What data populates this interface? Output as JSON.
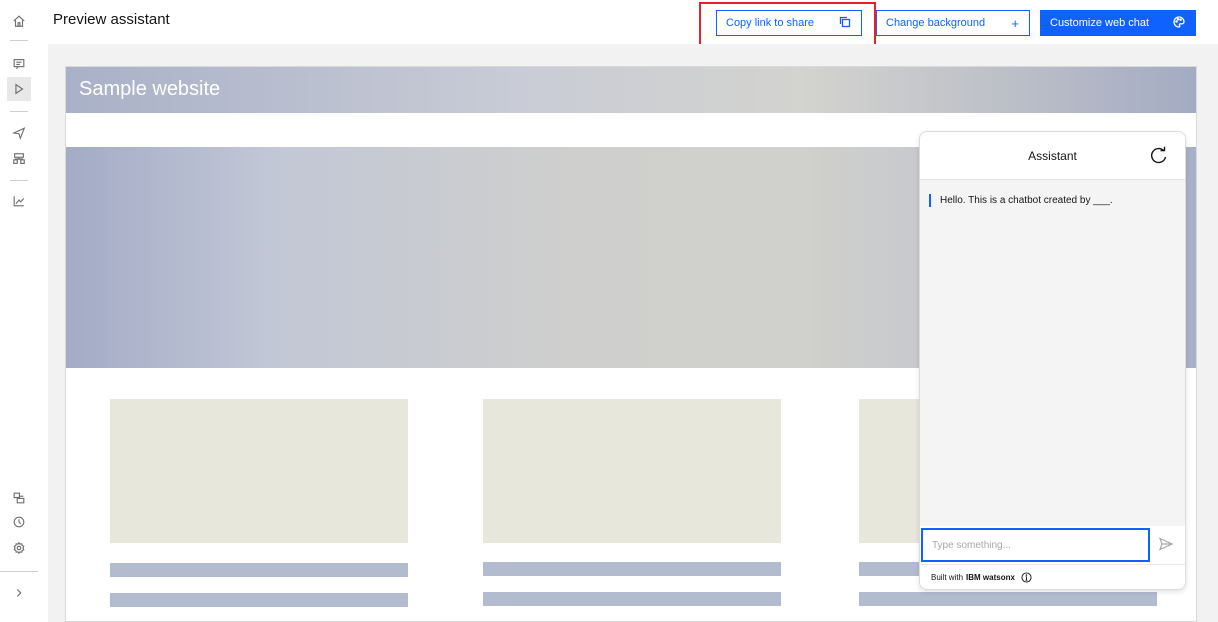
{
  "header": {
    "title": "Preview assistant",
    "copy_link_label": "Copy link to share",
    "change_background_label": "Change background",
    "change_background_icon": "+",
    "customize_label": "Customize web chat"
  },
  "sidebar": {
    "items": [
      {
        "name": "home-icon"
      },
      {
        "name": "actions-icon"
      },
      {
        "name": "preview-icon",
        "active": true
      },
      {
        "name": "publish-icon"
      },
      {
        "name": "environments-icon"
      },
      {
        "name": "analytics-icon"
      },
      {
        "name": "integrations-icon"
      },
      {
        "name": "history-icon"
      },
      {
        "name": "settings-icon"
      },
      {
        "name": "expand-icon"
      }
    ]
  },
  "site": {
    "title": "Sample website"
  },
  "chat": {
    "title": "Assistant",
    "greeting": "Hello. This is a chatbot created by ___.",
    "input_placeholder": "Type something...",
    "footer_prefix": "Built with",
    "footer_brand": "IBM watsonx"
  },
  "colors": {
    "accent": "#0f62fe",
    "highlight": "#e0242b",
    "card": "#e8e7dc",
    "bar": "#b3bccf"
  }
}
